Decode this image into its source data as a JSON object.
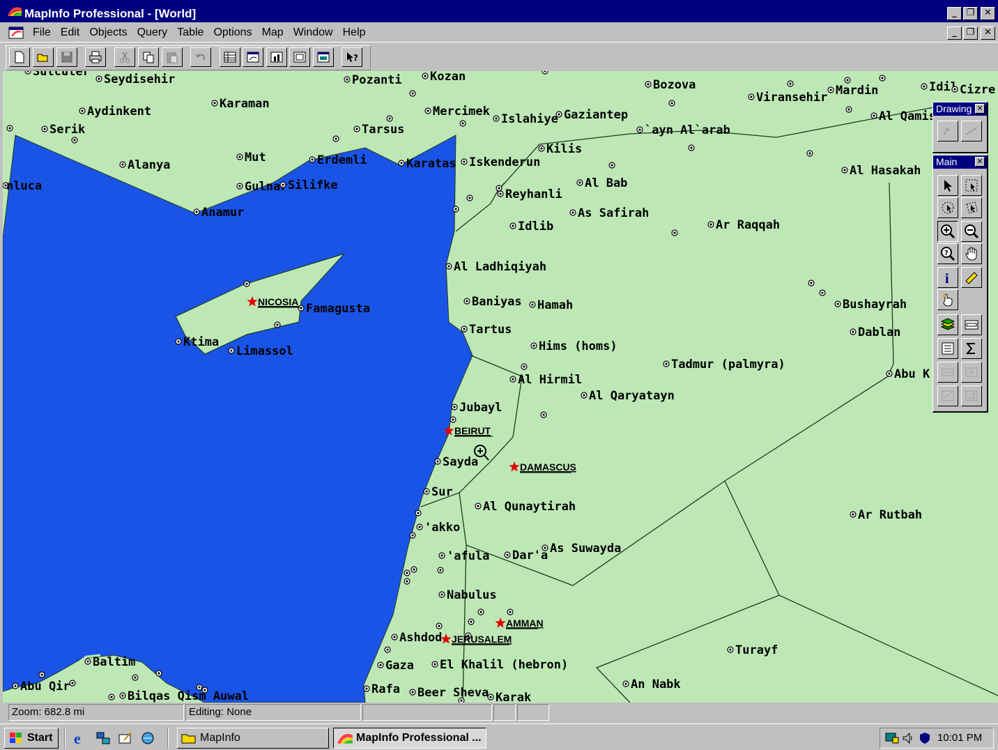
{
  "window": {
    "title": "MapInfo Professional - [World]",
    "minimize": "_",
    "restore": "❐",
    "close": "✕"
  },
  "menu": [
    "File",
    "Edit",
    "Objects",
    "Query",
    "Table",
    "Options",
    "Map",
    "Window",
    "Help"
  ],
  "toolbar": {
    "buttons": [
      "new-icon",
      "open-icon",
      "save-icon",
      "print-icon",
      "cut-icon",
      "copy-icon",
      "paste-icon",
      "undo-icon",
      "new-browser-icon",
      "new-mapper-icon",
      "new-grapher-icon",
      "new-layout-icon",
      "new-redistrict-icon",
      "help-pointer-icon"
    ]
  },
  "palettes": {
    "drawing_title": "Drawing",
    "main_title": "Main"
  },
  "map": {
    "colors": {
      "land": "#bde8b6",
      "sea": "#1a54e6",
      "border": "#1b3b1b",
      "capital": "#e00000"
    },
    "cities": [
      {
        "n": "Sutculer"
      },
      {
        "n": "Seydisehir"
      },
      {
        "n": "Pozanti"
      },
      {
        "n": "Kozan"
      },
      {
        "n": "Bozova"
      },
      {
        "n": "Mardin"
      },
      {
        "n": "Idil"
      },
      {
        "n": "Cizre"
      },
      {
        "n": "Aydinkent"
      },
      {
        "n": "Karaman"
      },
      {
        "n": "Mercimek"
      },
      {
        "n": "Islahiye"
      },
      {
        "n": "Gaziantep"
      },
      {
        "n": "Viransehir"
      },
      {
        "n": "Al Qamis"
      },
      {
        "n": "Serik"
      },
      {
        "n": "Tarsus"
      },
      {
        "n": "`ayn Al`arab"
      },
      {
        "n": "Kilis"
      },
      {
        "n": "Alanya"
      },
      {
        "n": "Mut"
      },
      {
        "n": "Erdemli"
      },
      {
        "n": "Karatas"
      },
      {
        "n": "Iskenderun"
      },
      {
        "n": "Al Hasakah"
      },
      {
        "n": "nluca"
      },
      {
        "n": "Gulnar"
      },
      {
        "n": "Silifke"
      },
      {
        "n": "Al Bab"
      },
      {
        "n": "Reyhanli"
      },
      {
        "n": "Anamur"
      },
      {
        "n": "As Safirah"
      },
      {
        "n": "Ar Raqqah"
      },
      {
        "n": "Idlib"
      },
      {
        "n": "Al Ladhiqiyah"
      },
      {
        "n": "Famagusta"
      },
      {
        "n": "Baniyas"
      },
      {
        "n": "Hamah"
      },
      {
        "n": "Bushayrah"
      },
      {
        "n": "Tartus"
      },
      {
        "n": "Dablan"
      },
      {
        "n": "Ktima"
      },
      {
        "n": "Limassol"
      },
      {
        "n": "Hims (homs)"
      },
      {
        "n": "Tadmur (palmyra)"
      },
      {
        "n": "Al Hirmil"
      },
      {
        "n": "Abu K"
      },
      {
        "n": "Al Qaryatayn"
      },
      {
        "n": "Jubayl"
      },
      {
        "n": "Sayda"
      },
      {
        "n": "Sur"
      },
      {
        "n": "Al Qunaytirah"
      },
      {
        "n": "Ar Rutbah"
      },
      {
        "n": "'akko"
      },
      {
        "n": "As Suwayda"
      },
      {
        "n": "'afula"
      },
      {
        "n": "Dar'a"
      },
      {
        "n": "Nabulus"
      },
      {
        "n": "Ashdod"
      },
      {
        "n": "Turayf"
      },
      {
        "n": "Baltim"
      },
      {
        "n": "Gaza"
      },
      {
        "n": "El Khalil (hebron)"
      },
      {
        "n": "An Nabk"
      },
      {
        "n": "Abu Qir"
      },
      {
        "n": "Rafa"
      },
      {
        "n": "Beer Sheva"
      },
      {
        "n": "Karak"
      },
      {
        "n": "Bilqas Qism Auwal"
      }
    ],
    "capitals": [
      "NICOSIA",
      "BEIRUT",
      "DAMASCUS",
      "AMMAN",
      "JERUSALEM"
    ]
  },
  "status": {
    "zoom": "Zoom: 682.8 mi",
    "editing": "Editing: None"
  },
  "taskbar": {
    "start": "Start",
    "folder_button": "MapInfo",
    "app_button": "MapInfo Professional ...",
    "clock": "10:01 PM"
  }
}
